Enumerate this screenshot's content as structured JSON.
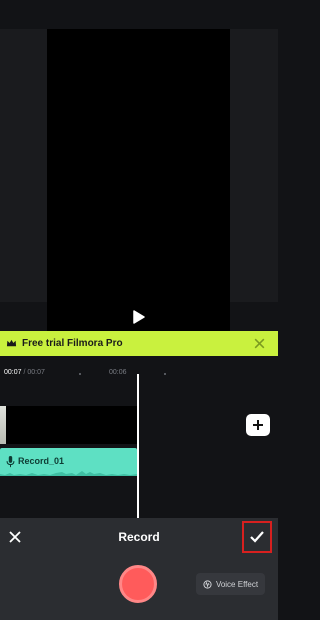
{
  "promo": {
    "text": "Free trial Filmora Pro"
  },
  "timeline": {
    "current_time": "00:07",
    "total_time": " / 00:07",
    "mark_time": "00:06"
  },
  "clips": {
    "record_label": "Record_01"
  },
  "sheet": {
    "title": "Record",
    "voice_effect_label": "Voice Effect"
  },
  "colors": {
    "promo_bg": "#c9f13e",
    "record_clip": "#5ee0c3",
    "record_button": "#ff5b5b",
    "confirm_highlight": "#d7201f"
  },
  "icons": [
    "play-icon",
    "crown-icon",
    "close-icon",
    "plus-icon",
    "mic-icon",
    "checkmark-icon",
    "voice-effect-icon"
  ]
}
